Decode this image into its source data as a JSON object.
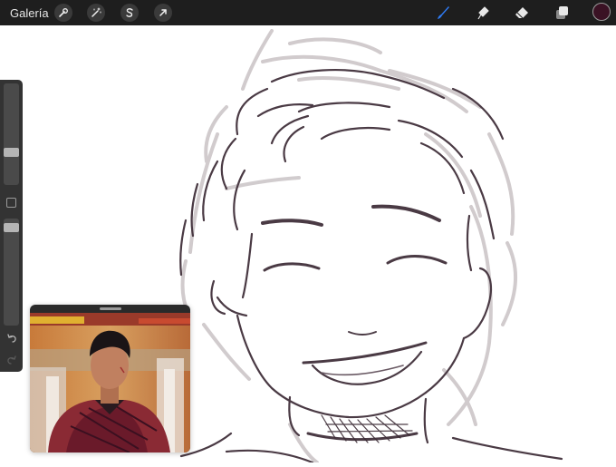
{
  "topbar": {
    "gallery_label": "Galería",
    "left_tools": [
      {
        "name": "actions",
        "icon": "wrench-icon"
      },
      {
        "name": "adjustments",
        "icon": "magic-wand-icon"
      },
      {
        "name": "selection",
        "icon": "selection-s-icon"
      },
      {
        "name": "transform",
        "icon": "arrow-cursor-icon"
      }
    ],
    "right_tools": [
      {
        "name": "brush",
        "icon": "brush-icon",
        "active": true
      },
      {
        "name": "smudge",
        "icon": "smudge-icon"
      },
      {
        "name": "eraser",
        "icon": "eraser-icon"
      },
      {
        "name": "layers",
        "icon": "layers-icon"
      }
    ],
    "active_tool_color": "#2f7cf6",
    "current_color": "#3a1224"
  },
  "sidebar": {
    "brush_size_level": 0.3,
    "opacity_level": 0.95,
    "icons": [
      "square-modify-icon",
      "undo-icon",
      "redo-icon"
    ]
  },
  "reference": {
    "subject": "photo-of-man-in-red-costume"
  }
}
